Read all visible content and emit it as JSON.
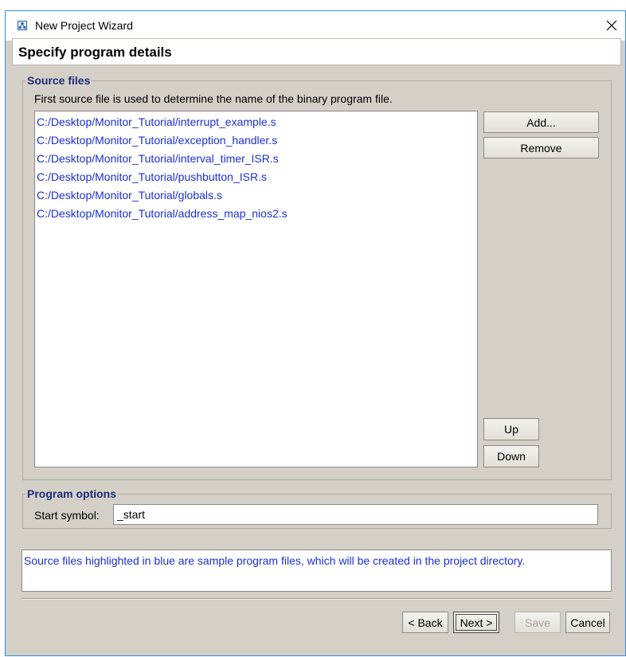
{
  "window": {
    "title": "New Project Wizard",
    "icon": "app-icon",
    "close_icon": "close-icon"
  },
  "header": {
    "title": "Specify program details"
  },
  "source_files": {
    "legend": "Source files",
    "description": "First source file is used to determine the name of the binary program file.",
    "files": [
      "C:/Desktop/Monitor_Tutorial/interrupt_example.s",
      "C:/Desktop/Monitor_Tutorial/exception_handler.s",
      "C:/Desktop/Monitor_Tutorial/interval_timer_ISR.s",
      "C:/Desktop/Monitor_Tutorial/pushbutton_ISR.s",
      "C:/Desktop/Monitor_Tutorial/globals.s",
      "C:/Desktop/Monitor_Tutorial/address_map_nios2.s"
    ],
    "add_label": "Add...",
    "remove_label": "Remove",
    "up_label": "Up",
    "down_label": "Down",
    "file_color": "#1b2fd4"
  },
  "program_options": {
    "legend": "Program options",
    "start_symbol_label": "Start symbol:",
    "start_symbol_value": "_start"
  },
  "info": {
    "text": "Source files highlighted in blue are sample program files, which will be created in the project directory."
  },
  "footer": {
    "back_label": "< Back",
    "next_label": "Next >",
    "save_label": "Save",
    "cancel_label": "Cancel",
    "save_disabled": true
  },
  "colors": {
    "window_bg": "#d4d0c8",
    "legend_text": "#1a2c78",
    "link_blue": "#1b2fd4",
    "window_border": "#3a8ad6"
  }
}
